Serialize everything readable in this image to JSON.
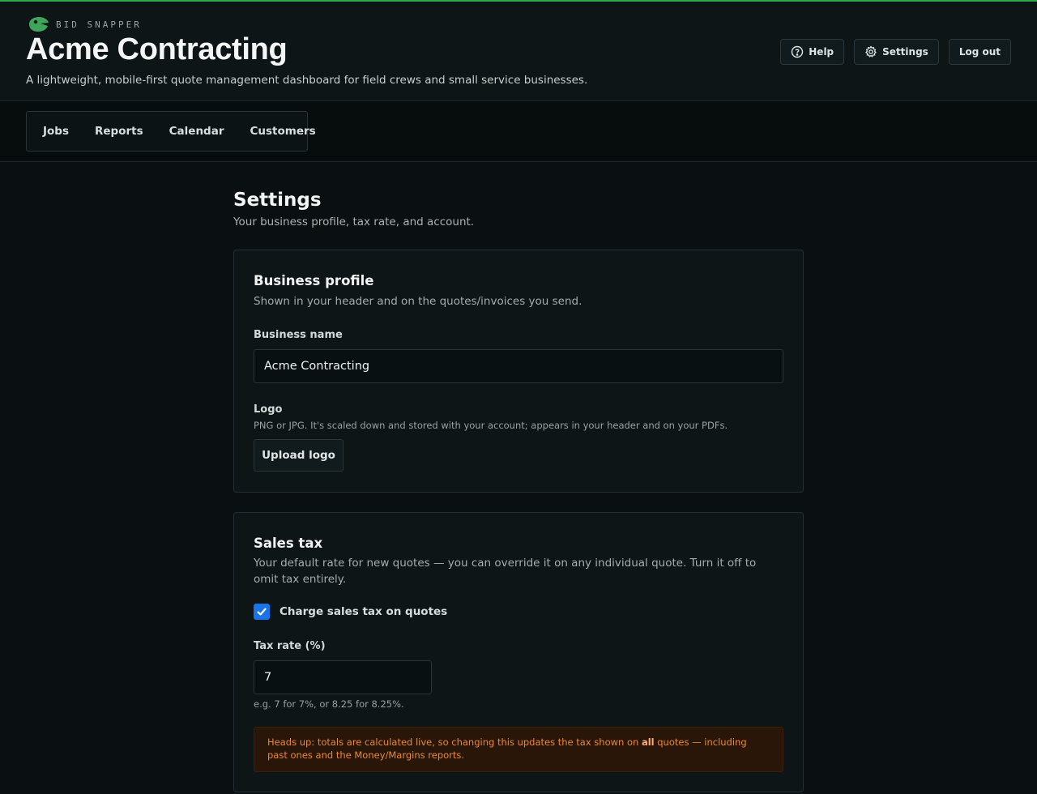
{
  "brand": {
    "name": "BID SNAPPER",
    "accent_color": "#2fa64a",
    "logo_icon": "snapper-logo-icon"
  },
  "header": {
    "business_name": "Acme Contracting",
    "tagline": "A lightweight, mobile-first quote management dashboard for field crews and small service businesses.",
    "buttons": {
      "help": "Help",
      "settings": "Settings",
      "logout": "Log out"
    }
  },
  "nav": {
    "items": [
      "Jobs",
      "Reports",
      "Calendar",
      "Customers"
    ]
  },
  "page": {
    "title": "Settings",
    "subtitle": "Your business profile, tax rate, and account."
  },
  "business_profile": {
    "title": "Business profile",
    "description": "Shown in your header and on the quotes/invoices you send.",
    "name_label": "Business name",
    "name_value": "Acme Contracting",
    "logo_label": "Logo",
    "logo_hint": "PNG or JPG. It's scaled down and stored with your account; appears in your header and on your PDFs.",
    "upload_label": "Upload logo"
  },
  "sales_tax": {
    "title": "Sales tax",
    "description": "Your default rate for new quotes — you can override it on any individual quote. Turn it off to omit tax entirely.",
    "charge_label": "Charge sales tax on quotes",
    "charge_checked": true,
    "rate_label": "Tax rate (%)",
    "rate_value": "7",
    "rate_hint": "e.g. 7 for 7%, or 8.25 for 8.25%.",
    "warning_pre": "Heads up: totals are calculated live, so changing this updates the tax shown on ",
    "warning_bold": "all",
    "warning_post": " quotes — including past ones and the Money/Margins reports.",
    "warning_color": "#e78a38",
    "checkbox_color": "#1a73e8"
  }
}
